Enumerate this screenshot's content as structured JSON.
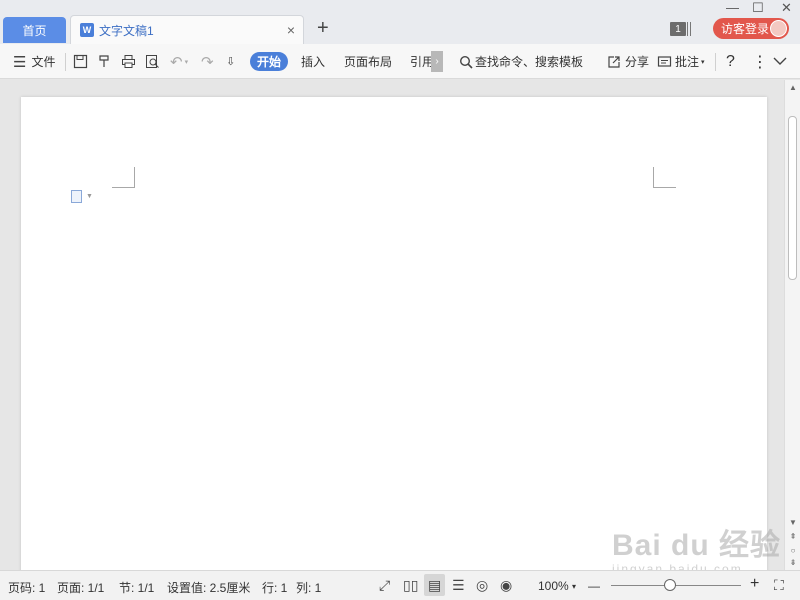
{
  "tabs": {
    "home_label": "首页",
    "doc_icon": "W",
    "doc_label": "文字文稿1",
    "close": "×",
    "new_tab": "+"
  },
  "window": {
    "minimize": "—",
    "maximize": "☐",
    "close": "✕",
    "notification_count": "1",
    "login_label": "访客登录"
  },
  "toolbar": {
    "menu_icon": "☰",
    "file_label": "文件",
    "save_icon": "💾",
    "format_painter_icon": "⌧",
    "print_icon": "⎙",
    "preview_icon": "🔍",
    "undo_icon": "↶",
    "redo_icon": "↷",
    "customize_icon": "⇩",
    "tab_home": "开始",
    "tab_insert": "插入",
    "tab_layout": "页面布局",
    "tab_reference": "引用",
    "more_tabs": "›",
    "search_placeholder": "查找命令、搜索模板",
    "share_label": "分享",
    "comment_label": "批注",
    "help": "?",
    "more": "⋮",
    "collapse": "﹀"
  },
  "statusbar": {
    "page_no": "页码: 1",
    "pages": "页面: 1/1",
    "section": "节: 1/1",
    "setting": "设置值: 2.5厘米",
    "row": "行: 1",
    "col": "列: 1",
    "zoom": "100%",
    "zoom_caret": "▾",
    "zoom_out": "—",
    "zoom_in": "+",
    "zoom_level": 0.45
  },
  "watermark": {
    "main": "Bai du 经验",
    "sub": "jingyan.baidu.com"
  },
  "colors": {
    "accent": "#4a7fd9",
    "home_tab": "#5b8de6",
    "login": "#e2574c"
  }
}
